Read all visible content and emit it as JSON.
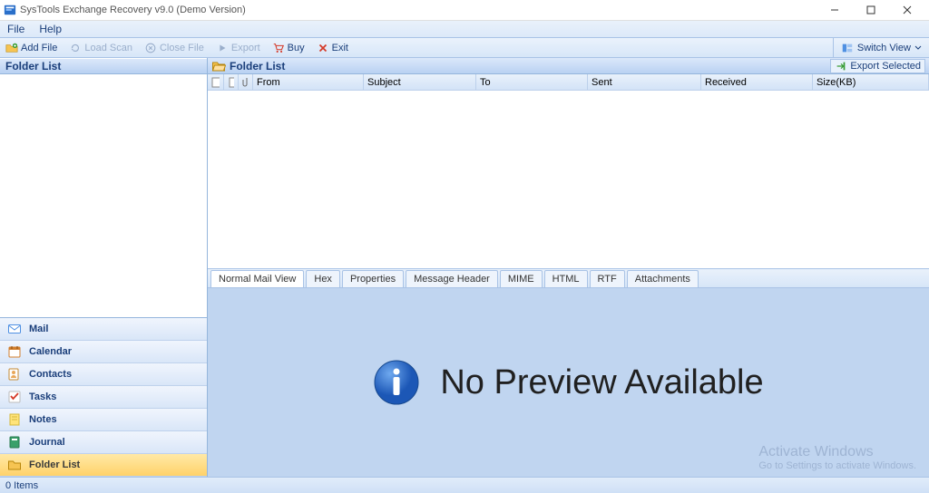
{
  "title": "SysTools Exchange Recovery v9.0 (Demo Version)",
  "menubar": {
    "file": "File",
    "help": "Help"
  },
  "toolbar": {
    "add_file": "Add File",
    "load_scan": "Load Scan",
    "close_file": "Close File",
    "export": "Export",
    "buy": "Buy",
    "exit": "Exit",
    "switch_view": "Switch View"
  },
  "left": {
    "header": "Folder List",
    "nav": {
      "mail": "Mail",
      "calendar": "Calendar",
      "contacts": "Contacts",
      "tasks": "Tasks",
      "notes": "Notes",
      "journal": "Journal",
      "folder_list": "Folder List"
    }
  },
  "folderlist": {
    "title": "Folder List",
    "export_selected": "Export Selected",
    "columns": {
      "from": "From",
      "subject": "Subject",
      "to": "To",
      "sent": "Sent",
      "received": "Received",
      "size": "Size(KB)"
    }
  },
  "tabs": {
    "normal": "Normal Mail View",
    "hex": "Hex",
    "properties": "Properties",
    "msghdr": "Message Header",
    "mime": "MIME",
    "html": "HTML",
    "rtf": "RTF",
    "attach": "Attachments"
  },
  "preview": {
    "no_preview": "No Preview Available"
  },
  "watermark": {
    "line1": "Activate Windows",
    "line2": "Go to Settings to activate Windows."
  },
  "status": {
    "items": "0 Items"
  }
}
